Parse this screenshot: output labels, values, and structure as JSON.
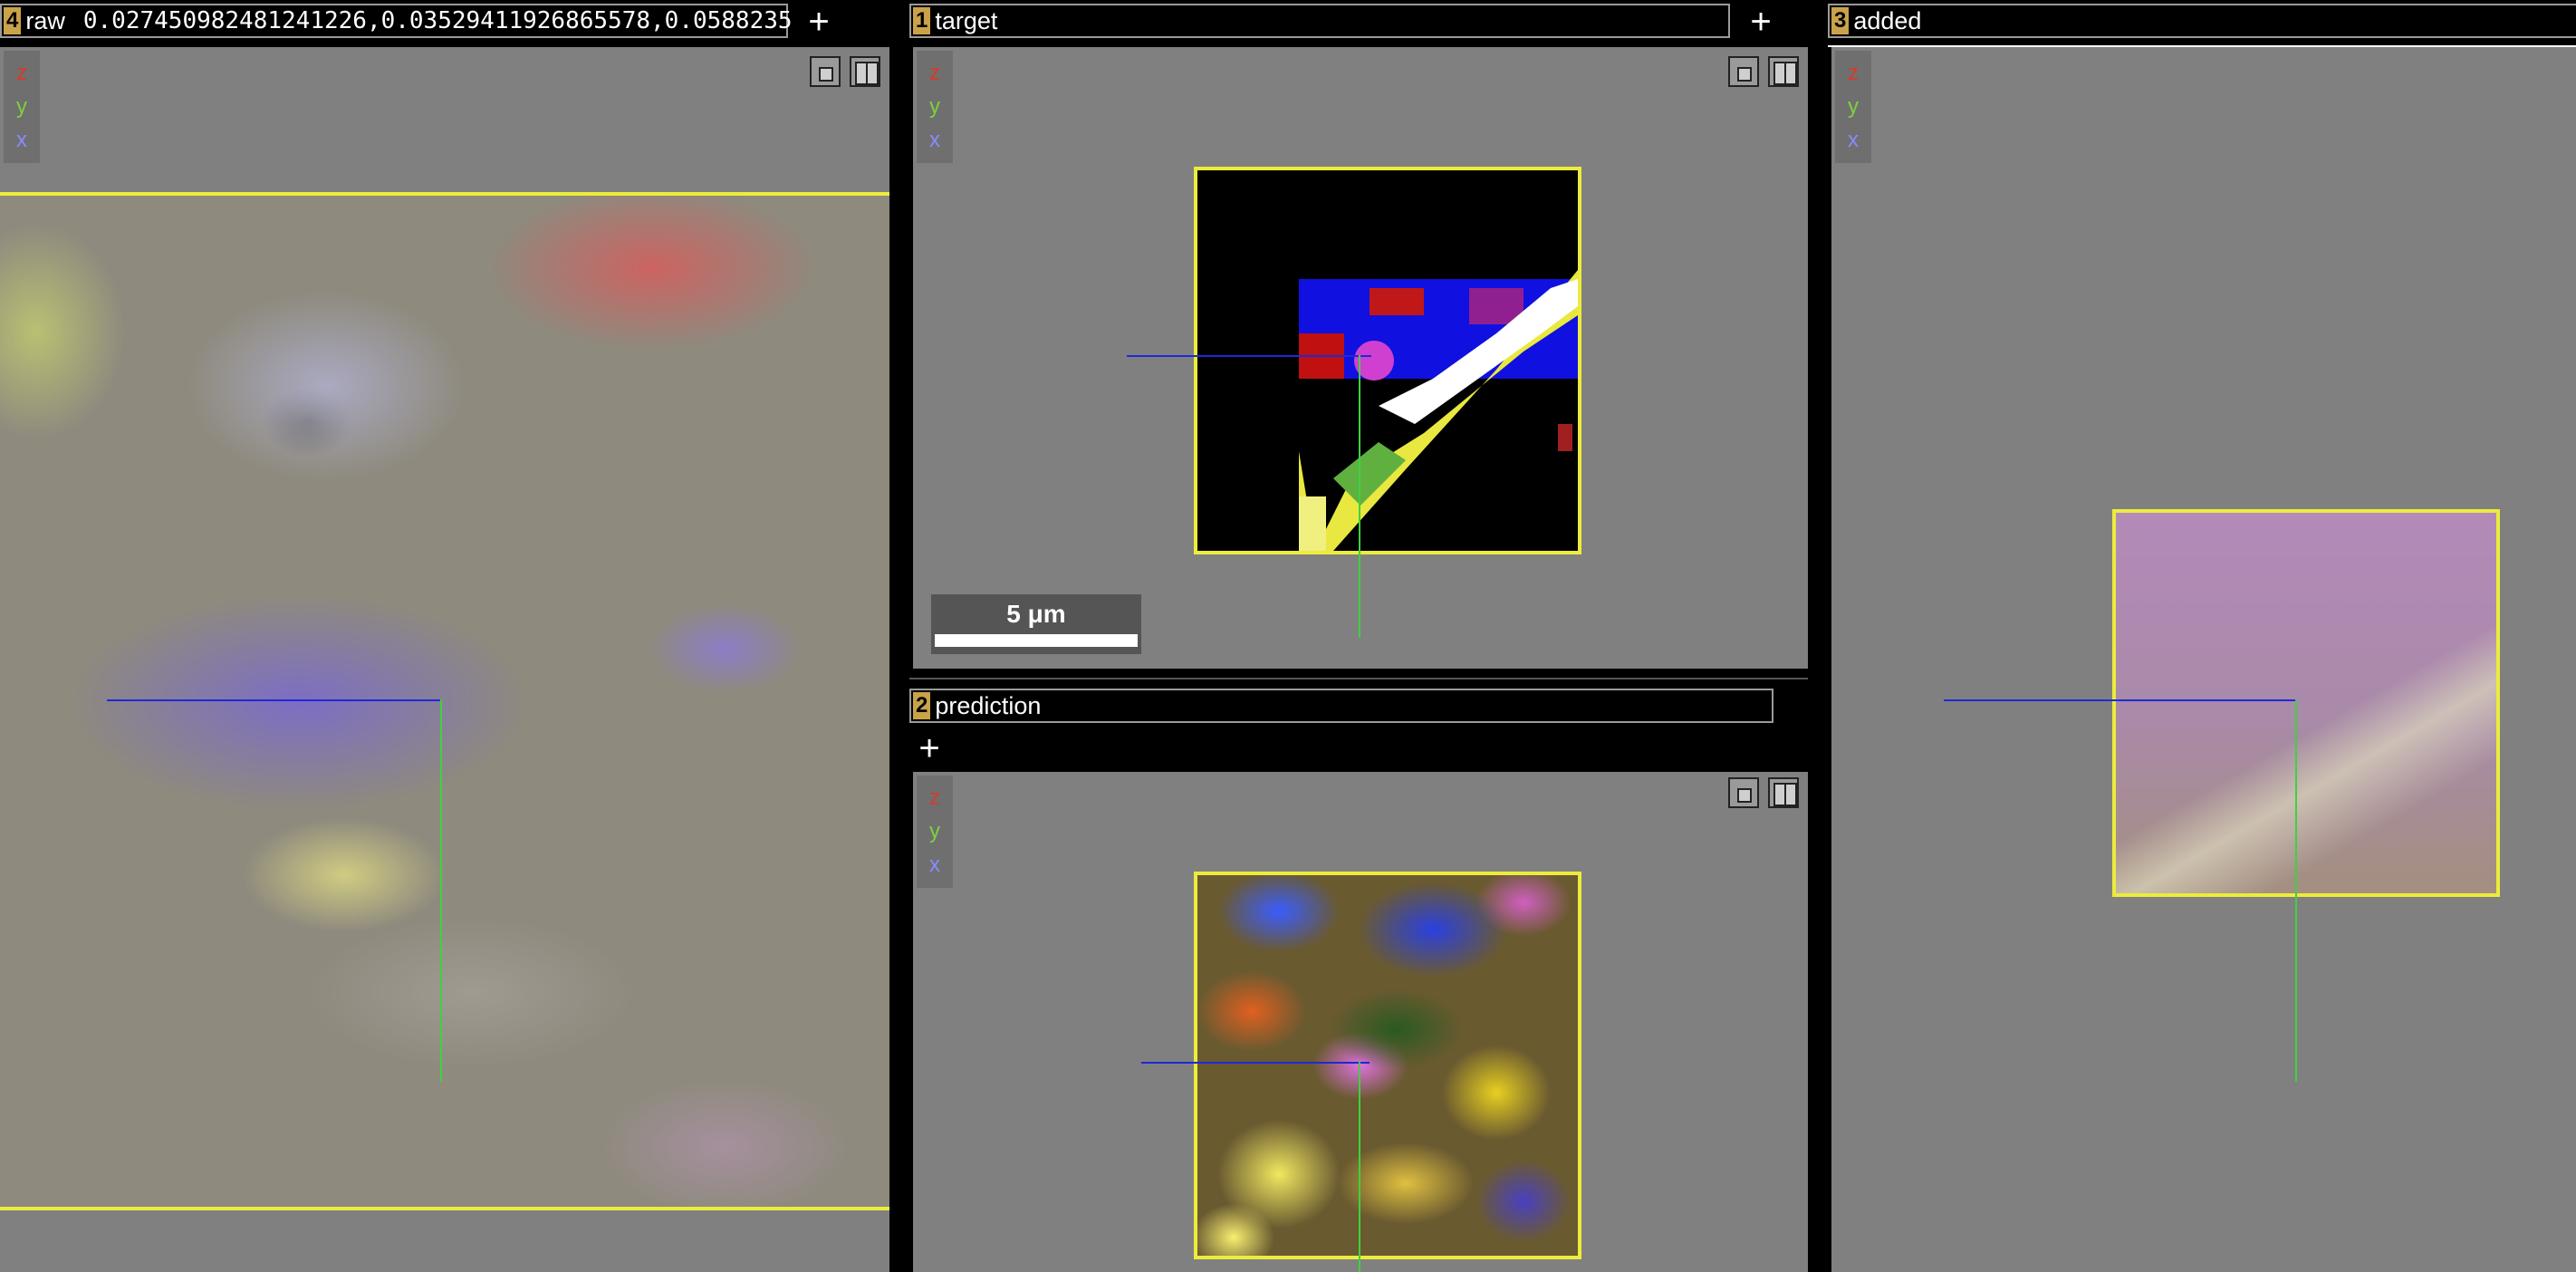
{
  "layers": {
    "raw": {
      "num": "4",
      "name": "raw",
      "value": "0.027450982481241226,0.03529411926865578,0.0588235"
    },
    "target": {
      "num": "1",
      "name": "target"
    },
    "prediction": {
      "num": "2",
      "name": "prediction"
    },
    "added": {
      "num": "3",
      "name": "added"
    }
  },
  "add_layer_symbol": "+",
  "axes": {
    "z": "z",
    "y": "y",
    "x": "x"
  },
  "scale_bar": {
    "label": "5 μm"
  },
  "icons": {
    "layout_single": "layout-single-icon",
    "layout_split": "layout-split-icon"
  },
  "colors": {
    "frame": "#ecec3c",
    "crosshair_h": "#1d2ad6",
    "crosshair_v": "#3fd13f",
    "panel_bg": "#808080",
    "layer_num_bg": "#c9a24a"
  }
}
